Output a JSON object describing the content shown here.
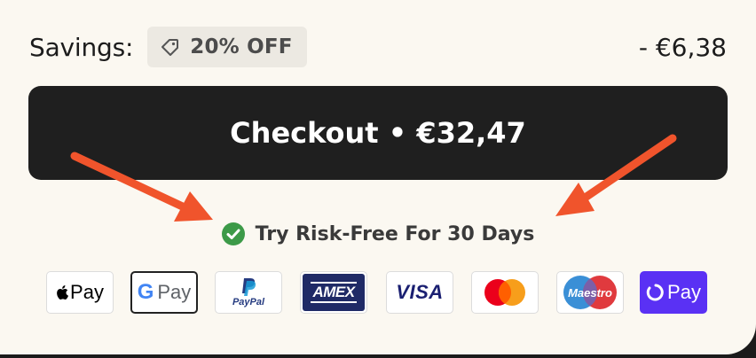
{
  "savings": {
    "label": "Savings:",
    "badge": "20% OFF",
    "amount": "- €6,38"
  },
  "checkout": {
    "label": "Checkout • €32,47"
  },
  "guarantee": {
    "text": "Try Risk-Free For 30 Days"
  },
  "payments": {
    "apple": "Pay",
    "google_g": "G",
    "google": "Pay",
    "paypal": "PayPal",
    "amex": "AMEX",
    "visa": "VISA",
    "maestro": "Maestro",
    "shop": "Pay"
  },
  "colors": {
    "panel": "#fbf8f1",
    "button": "#1f1f1f",
    "arrow": "#f0542c",
    "check": "#3c9a48",
    "badge": "#ece9e2"
  }
}
